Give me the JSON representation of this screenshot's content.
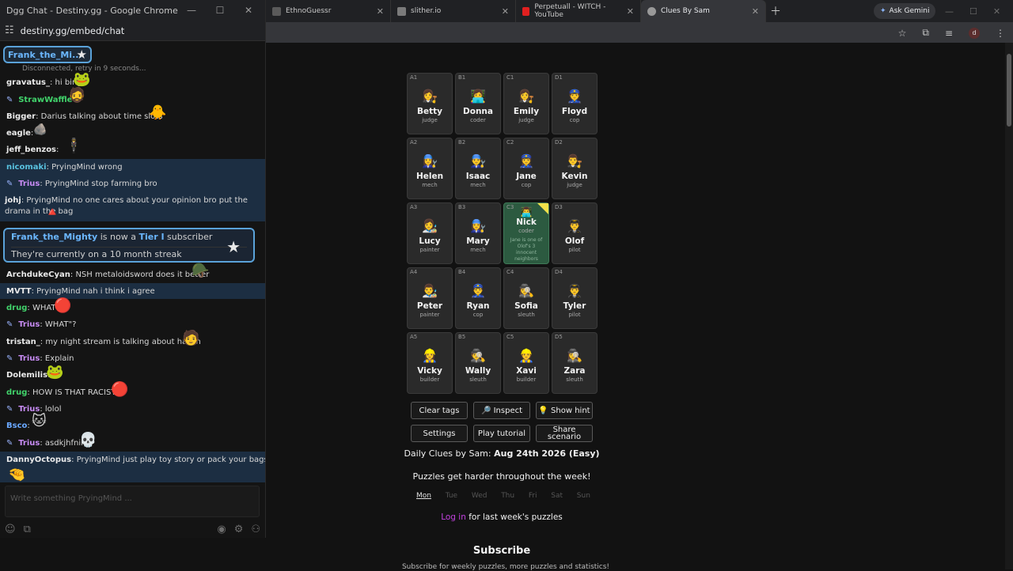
{
  "chat_window": {
    "title": "Dgg Chat - Destiny.gg - Google Chrome",
    "url": "destiny.gg/embed/chat",
    "pinned_user": "Frank_the_Mi...",
    "status": "Disconnected, retry in 9 seconds...",
    "input_placeholder": "Write something PryingMind ..."
  },
  "messages": [
    {
      "user": "gravatus_",
      "text": "hi bing"
    },
    {
      "user": "StrawWaffle",
      "text": ""
    },
    {
      "user": "Bigger",
      "text": "Darius talking about time slots"
    },
    {
      "user": "eagle",
      "text": ""
    },
    {
      "user": "jeff_benzos",
      "text": ""
    },
    {
      "user": "nicomaki",
      "text": "PryingMind wrong"
    },
    {
      "user": "Trius",
      "text": "PryingMind stop farming bro"
    },
    {
      "user": "johj",
      "text": "PryingMind no one cares about your opinion bro put the drama in the bag"
    },
    {
      "user": "ArchdukeCyan",
      "text": "NSH metaloidsword does it better"
    },
    {
      "user": "MVTT",
      "text": "PryingMind nah i think i agree"
    },
    {
      "user": "drug",
      "text": "WHAT"
    },
    {
      "user": "Trius",
      "text": "WHAT\"?"
    },
    {
      "user": "tristan_",
      "text": "my night stream is talking about hasan"
    },
    {
      "user": "Trius",
      "text": "Explain"
    },
    {
      "user": "Dolemilis",
      "text": ""
    },
    {
      "user": "drug",
      "text": "HOW IS THAT RACIST"
    },
    {
      "user": "Trius",
      "text": "lolol"
    },
    {
      "user": "Bsco",
      "text": ""
    },
    {
      "user": "Trius",
      "text": "asdkjhfnik"
    },
    {
      "user": "DannyOctopus",
      "text": "PryingMind just play toy story or pack your bags"
    }
  ],
  "sub_card": {
    "user": "Frank_the_Mighty",
    "middle": "is now a",
    "tier": "Tier I",
    "suffix": "subscriber",
    "streak": "They're currently on a 10 month streak"
  },
  "browser": {
    "tabs": [
      {
        "label": "EthnoGuessr",
        "active": false
      },
      {
        "label": "slither.io",
        "active": false
      },
      {
        "label": "Perpetuall - WITCH - YouTube",
        "active": false
      },
      {
        "label": "Clues By Sam",
        "active": true
      }
    ],
    "ask_gemini": "Ask Gemini",
    "profile_initial": "d"
  },
  "grid": [
    {
      "coord": "A1",
      "name": "Betty",
      "role": "judge",
      "avatar": "👩‍⚖️"
    },
    {
      "coord": "B1",
      "name": "Donna",
      "role": "coder",
      "avatar": "👩‍💻"
    },
    {
      "coord": "C1",
      "name": "Emily",
      "role": "judge",
      "avatar": "👩‍⚖️"
    },
    {
      "coord": "D1",
      "name": "Floyd",
      "role": "cop",
      "avatar": "👮"
    },
    {
      "coord": "A2",
      "name": "Helen",
      "role": "mech",
      "avatar": "👩‍🔧"
    },
    {
      "coord": "B2",
      "name": "Isaac",
      "role": "mech",
      "avatar": "👨‍🔧"
    },
    {
      "coord": "C2",
      "name": "Jane",
      "role": "cop",
      "avatar": "👮‍♀️"
    },
    {
      "coord": "D2",
      "name": "Kevin",
      "role": "judge",
      "avatar": "👨‍⚖️"
    },
    {
      "coord": "A3",
      "name": "Lucy",
      "role": "painter",
      "avatar": "👩‍🎨"
    },
    {
      "coord": "B3",
      "name": "Mary",
      "role": "mech",
      "avatar": "👩‍🔧"
    },
    {
      "coord": "C3",
      "name": "Nick",
      "role": "coder",
      "avatar": "👨‍💻",
      "revealed": true,
      "hint": "Jane is one of Olof's 3 innocent neighbors"
    },
    {
      "coord": "D3",
      "name": "Olof",
      "role": "pilot",
      "avatar": "👨‍✈️"
    },
    {
      "coord": "A4",
      "name": "Peter",
      "role": "painter",
      "avatar": "👨‍🎨"
    },
    {
      "coord": "B4",
      "name": "Ryan",
      "role": "cop",
      "avatar": "👮‍♂️"
    },
    {
      "coord": "C4",
      "name": "Sofia",
      "role": "sleuth",
      "avatar": "🕵️‍♀️"
    },
    {
      "coord": "D4",
      "name": "Tyler",
      "role": "pilot",
      "avatar": "👨‍✈️"
    },
    {
      "coord": "A5",
      "name": "Vicky",
      "role": "builder",
      "avatar": "👷‍♀️"
    },
    {
      "coord": "B5",
      "name": "Wally",
      "role": "sleuth",
      "avatar": "🕵️"
    },
    {
      "coord": "C5",
      "name": "Xavi",
      "role": "builder",
      "avatar": "👷"
    },
    {
      "coord": "D5",
      "name": "Zara",
      "role": "sleuth",
      "avatar": "🕵️‍♀️"
    }
  ],
  "buttons": {
    "clear_tags": "Clear tags",
    "inspect": "🔎 Inspect",
    "show_hint": "💡 Show hint",
    "settings": "Settings",
    "play_tutorial": "Play tutorial",
    "share_scenario": "Share scenario"
  },
  "daily": {
    "prefix": "Daily Clues by Sam:",
    "date": "Aug 24th 2026 (Easy)"
  },
  "harder_text": "Puzzles get harder throughout the week!",
  "days": [
    "Mon",
    "Tue",
    "Wed",
    "Thu",
    "Fri",
    "Sat",
    "Sun"
  ],
  "active_day": "Mon",
  "login": {
    "link": "Log in",
    "suffix": "for last week's puzzles"
  },
  "subscribe": {
    "title": "Subscribe",
    "text": "Subscribe for weekly puzzles, more puzzles and statistics!"
  }
}
